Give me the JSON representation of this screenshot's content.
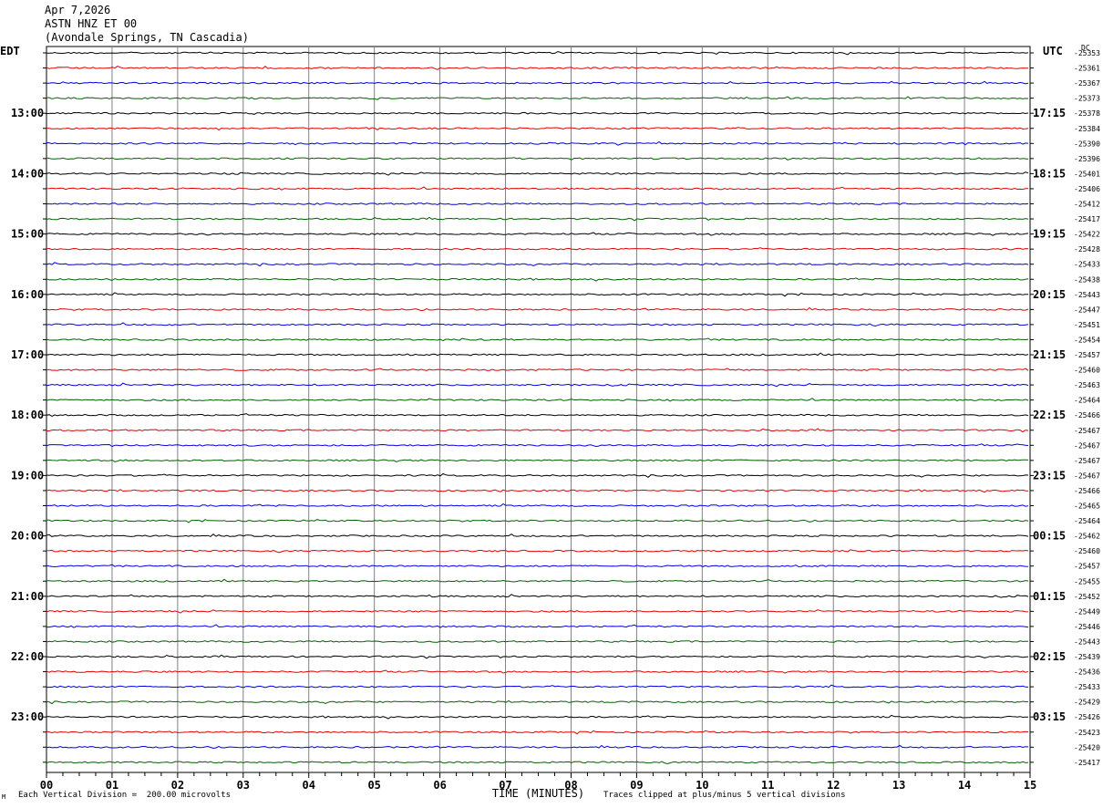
{
  "header": {
    "date": "Apr 7,2026",
    "station": "ASTN HNZ ET 00",
    "location": "(Avondale Springs, TN Cascadia)"
  },
  "left_tz": "EDT",
  "right_tz": "UTC",
  "dc_label": "DC",
  "footer": {
    "scale": "Each Vertical Division =  200.00 microvolts",
    "clip": "Traces clipped at plus/minus 5 vertical divisions",
    "logo": "M"
  },
  "colors": {
    "trace_cycle": [
      "#000000",
      "#e00000",
      "#0000e0",
      "#006000"
    ],
    "grid": "#808080"
  },
  "chart_data": {
    "type": "line",
    "title": "ASTN HNZ ET 00",
    "xlabel": "TIME (MINUTES)",
    "ylabel": "",
    "x_ticks": [
      "00",
      "01",
      "02",
      "03",
      "04",
      "05",
      "06",
      "07",
      "08",
      "09",
      "10",
      "11",
      "12",
      "13",
      "14",
      "15"
    ],
    "xlim": [
      0,
      15
    ],
    "minutes_per_line": 15,
    "left_hour_labels": [
      "13:00",
      "14:00",
      "15:00",
      "16:00",
      "17:00",
      "18:00",
      "19:00",
      "20:00",
      "21:00",
      "22:00",
      "23:00"
    ],
    "right_hour_labels": [
      "17:15",
      "18:15",
      "19:15",
      "20:15",
      "21:15",
      "22:15",
      "23:15",
      "00:15",
      "01:15",
      "02:15",
      "03:15"
    ],
    "dc_offsets": [
      "-25353",
      "-25361",
      "-25367",
      "-25373",
      "-25378",
      "-25384",
      "-25390",
      "-25396",
      "-25401",
      "-25406",
      "-25412",
      "-25417",
      "-25422",
      "-25428",
      "-25433",
      "-25438",
      "-25443",
      "-25447",
      "-25451",
      "-25454",
      "-25457",
      "-25460",
      "-25463",
      "-25464",
      "-25466",
      "-25467",
      "-25467",
      "-25467",
      "-25467",
      "-25466",
      "-25465",
      "-25464",
      "-25462",
      "-25460",
      "-25457",
      "-25455",
      "-25452",
      "-25449",
      "-25446",
      "-25443",
      "-25439",
      "-25436",
      "-25433",
      "-25429",
      "-25426",
      "-25423",
      "-25420",
      "-25417"
    ],
    "grid": true,
    "notes": "Helicorder: each row is a 15 minute trace; traces show low-amplitude noise with no visible events."
  }
}
